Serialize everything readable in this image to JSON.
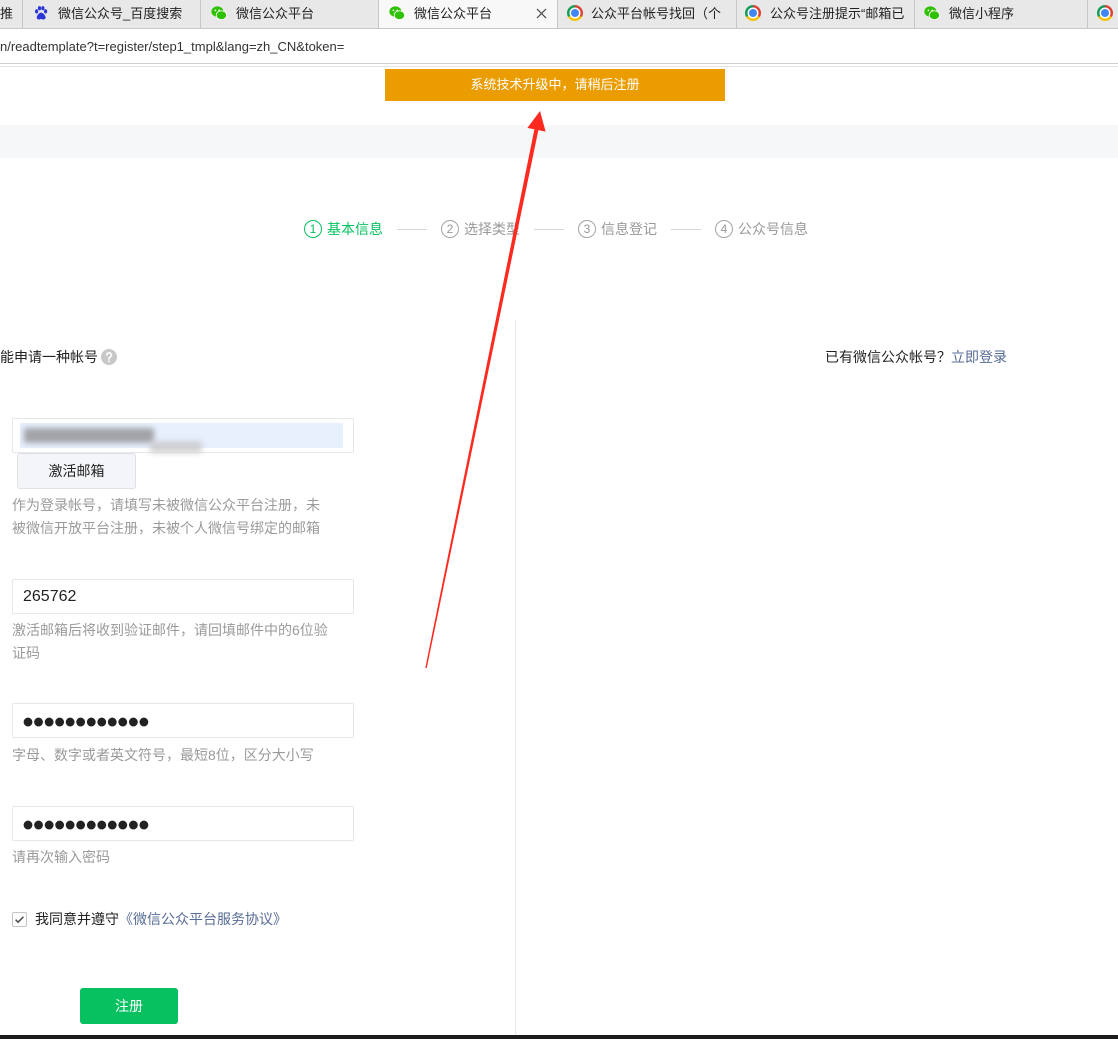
{
  "browser": {
    "tabs": [
      {
        "label": "推"
      },
      {
        "label": "微信公众号_百度搜索",
        "icon": "baidu-icon"
      },
      {
        "label": "微信公众平台",
        "icon": "wechat-icon"
      },
      {
        "label": "微信公众平台",
        "icon": "wechat-icon",
        "active": true,
        "close_icon": "close-icon"
      },
      {
        "label": "公众平台帐号找回（个",
        "icon": "browser-icon"
      },
      {
        "label": "公众号注册提示“邮箱已",
        "icon": "browser-icon"
      },
      {
        "label": "微信小程序",
        "icon": "wechat-icon"
      },
      {
        "label": "",
        "icon": "browser-icon"
      }
    ],
    "address": "n/readtemplate?t=register/step1_tmpl&lang=zh_CN&token="
  },
  "notice_banner": {
    "text": "系统技术升级中，请稍后注册"
  },
  "steps": [
    {
      "number": "1",
      "label": "基本信息",
      "state": "current"
    },
    {
      "number": "2",
      "label": "选择类型",
      "state": "pending"
    },
    {
      "number": "3",
      "label": "信息登记",
      "state": "pending"
    },
    {
      "number": "4",
      "label": "公众号信息",
      "state": "pending"
    }
  ],
  "form": {
    "title": "能申请一种帐号",
    "help_icon": "help-icon",
    "email": {
      "activate_button": "激活邮箱",
      "hint_lines": [
        "作为登录帐号，请填写未被微信公众平台注册，未",
        "被微信开放平台注册，未被个人微信号绑定的邮箱"
      ]
    },
    "verify_code": {
      "value": "265762",
      "hint_lines": [
        "激活邮箱后将收到验证邮件，请回填邮件中的6位验",
        "证码"
      ]
    },
    "password": {
      "masked_value": "●●●●●●●●●●●●",
      "hint_lines": [
        "字母、数字或者英文符号，最短8位，区分大小写"
      ]
    },
    "confirm_password": {
      "masked_value": "●●●●●●●●●●●●",
      "hint_lines": [
        "请再次输入密码"
      ]
    },
    "agreement": {
      "checked": true,
      "text": "我同意并遵守",
      "link": "《微信公众平台服务协议》"
    },
    "submit_button": "注册"
  },
  "login_prompt": {
    "text": "已有微信公众帐号？",
    "link": "立即登录"
  },
  "colors": {
    "brand_green": "#07c160",
    "link_blue": "#576b95",
    "banner_orange": "#eb9d00",
    "hint_gray": "#9a9a9a",
    "annotation_red": "#ff2a1f"
  }
}
